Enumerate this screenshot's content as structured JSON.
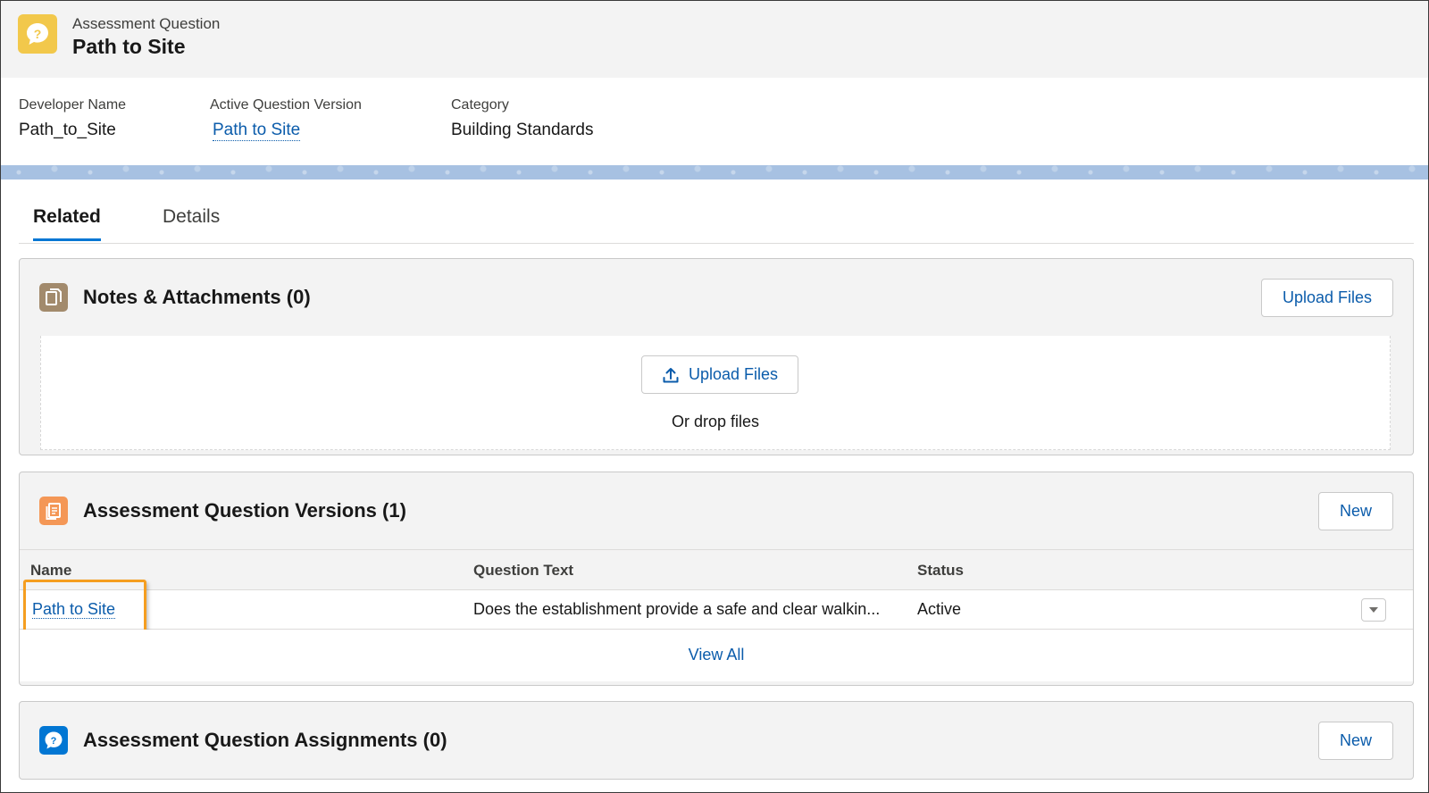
{
  "header": {
    "object_type": "Assessment Question",
    "title": "Path to Site",
    "icon": "question-bubble-icon",
    "icon_color": "#F2C84B"
  },
  "highlights": [
    {
      "label": "Developer Name",
      "value": "Path_to_Site",
      "is_link": false
    },
    {
      "label": "Active Question Version",
      "value": "Path to Site",
      "is_link": true
    },
    {
      "label": "Category",
      "value": "Building Standards",
      "is_link": false
    }
  ],
  "tabs": [
    {
      "label": "Related",
      "active": true
    },
    {
      "label": "Details",
      "active": false
    }
  ],
  "notes_card": {
    "title": "Notes & Attachments (0)",
    "icon": "file-icon",
    "icon_color": "#A28A6C",
    "header_button": "Upload Files",
    "upload_button": "Upload Files",
    "drop_text": "Or drop files"
  },
  "versions_card": {
    "title": "Assessment Question Versions (1)",
    "icon": "document-icon",
    "icon_color": "#F49756",
    "new_button": "New",
    "columns": [
      "Name",
      "Question Text",
      "Status"
    ],
    "rows": [
      {
        "name": "Path to Site",
        "question_text": "Does the establishment provide a safe and clear walkin...",
        "status": "Active"
      }
    ],
    "view_all": "View All"
  },
  "assignments_card": {
    "title": "Assessment Question Assignments (0)",
    "icon": "question-icon",
    "icon_color": "#0176D3",
    "new_button": "New"
  },
  "accent_color": "#0176D3",
  "link_color": "#0B5CAB",
  "highlight_color": "#F59E20"
}
